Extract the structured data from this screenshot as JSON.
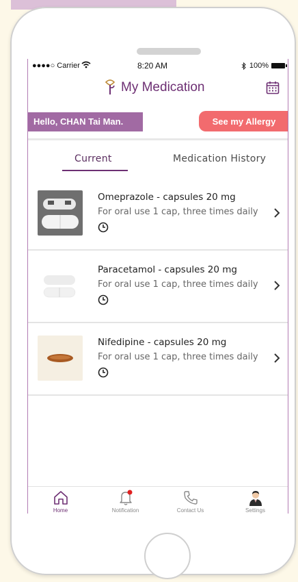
{
  "status_bar": {
    "carrier": "●●●●○ Carrier",
    "time": "8:20 AM",
    "battery": "100%"
  },
  "header": {
    "title": "My Medication",
    "logo_icon": "ribbon-logo-icon",
    "calendar_icon": "calendar-icon"
  },
  "greeting": "Hello, CHAN Tai Man.",
  "allergy_button": "See my Allergy",
  "tabs": [
    {
      "label": "Current",
      "active": true
    },
    {
      "label": "Medication History",
      "active": false
    }
  ],
  "medications": [
    {
      "name": "Omeprazole - capsules 20 mg",
      "instructions": "For oral use 1 cap, three times daily"
    },
    {
      "name": "Paracetamol - capsules 20 mg",
      "instructions": "For oral use 1 cap, three times daily"
    },
    {
      "name": "Nifedipine - capsules 20 mg",
      "instructions": "For oral use 1 cap, three times daily"
    }
  ],
  "bottom_nav": [
    {
      "label": "Home",
      "icon": "home-icon",
      "active": true
    },
    {
      "label": "Notification",
      "icon": "bell-icon",
      "active": false
    },
    {
      "label": "Contact Us",
      "icon": "phone-icon",
      "active": false
    },
    {
      "label": "Settings",
      "icon": "avatar",
      "active": false
    }
  ],
  "colors": {
    "brand_purple": "#6d2f73",
    "greeting_bg": "#a16aa3",
    "allergy_bg": "#f26b6e"
  }
}
